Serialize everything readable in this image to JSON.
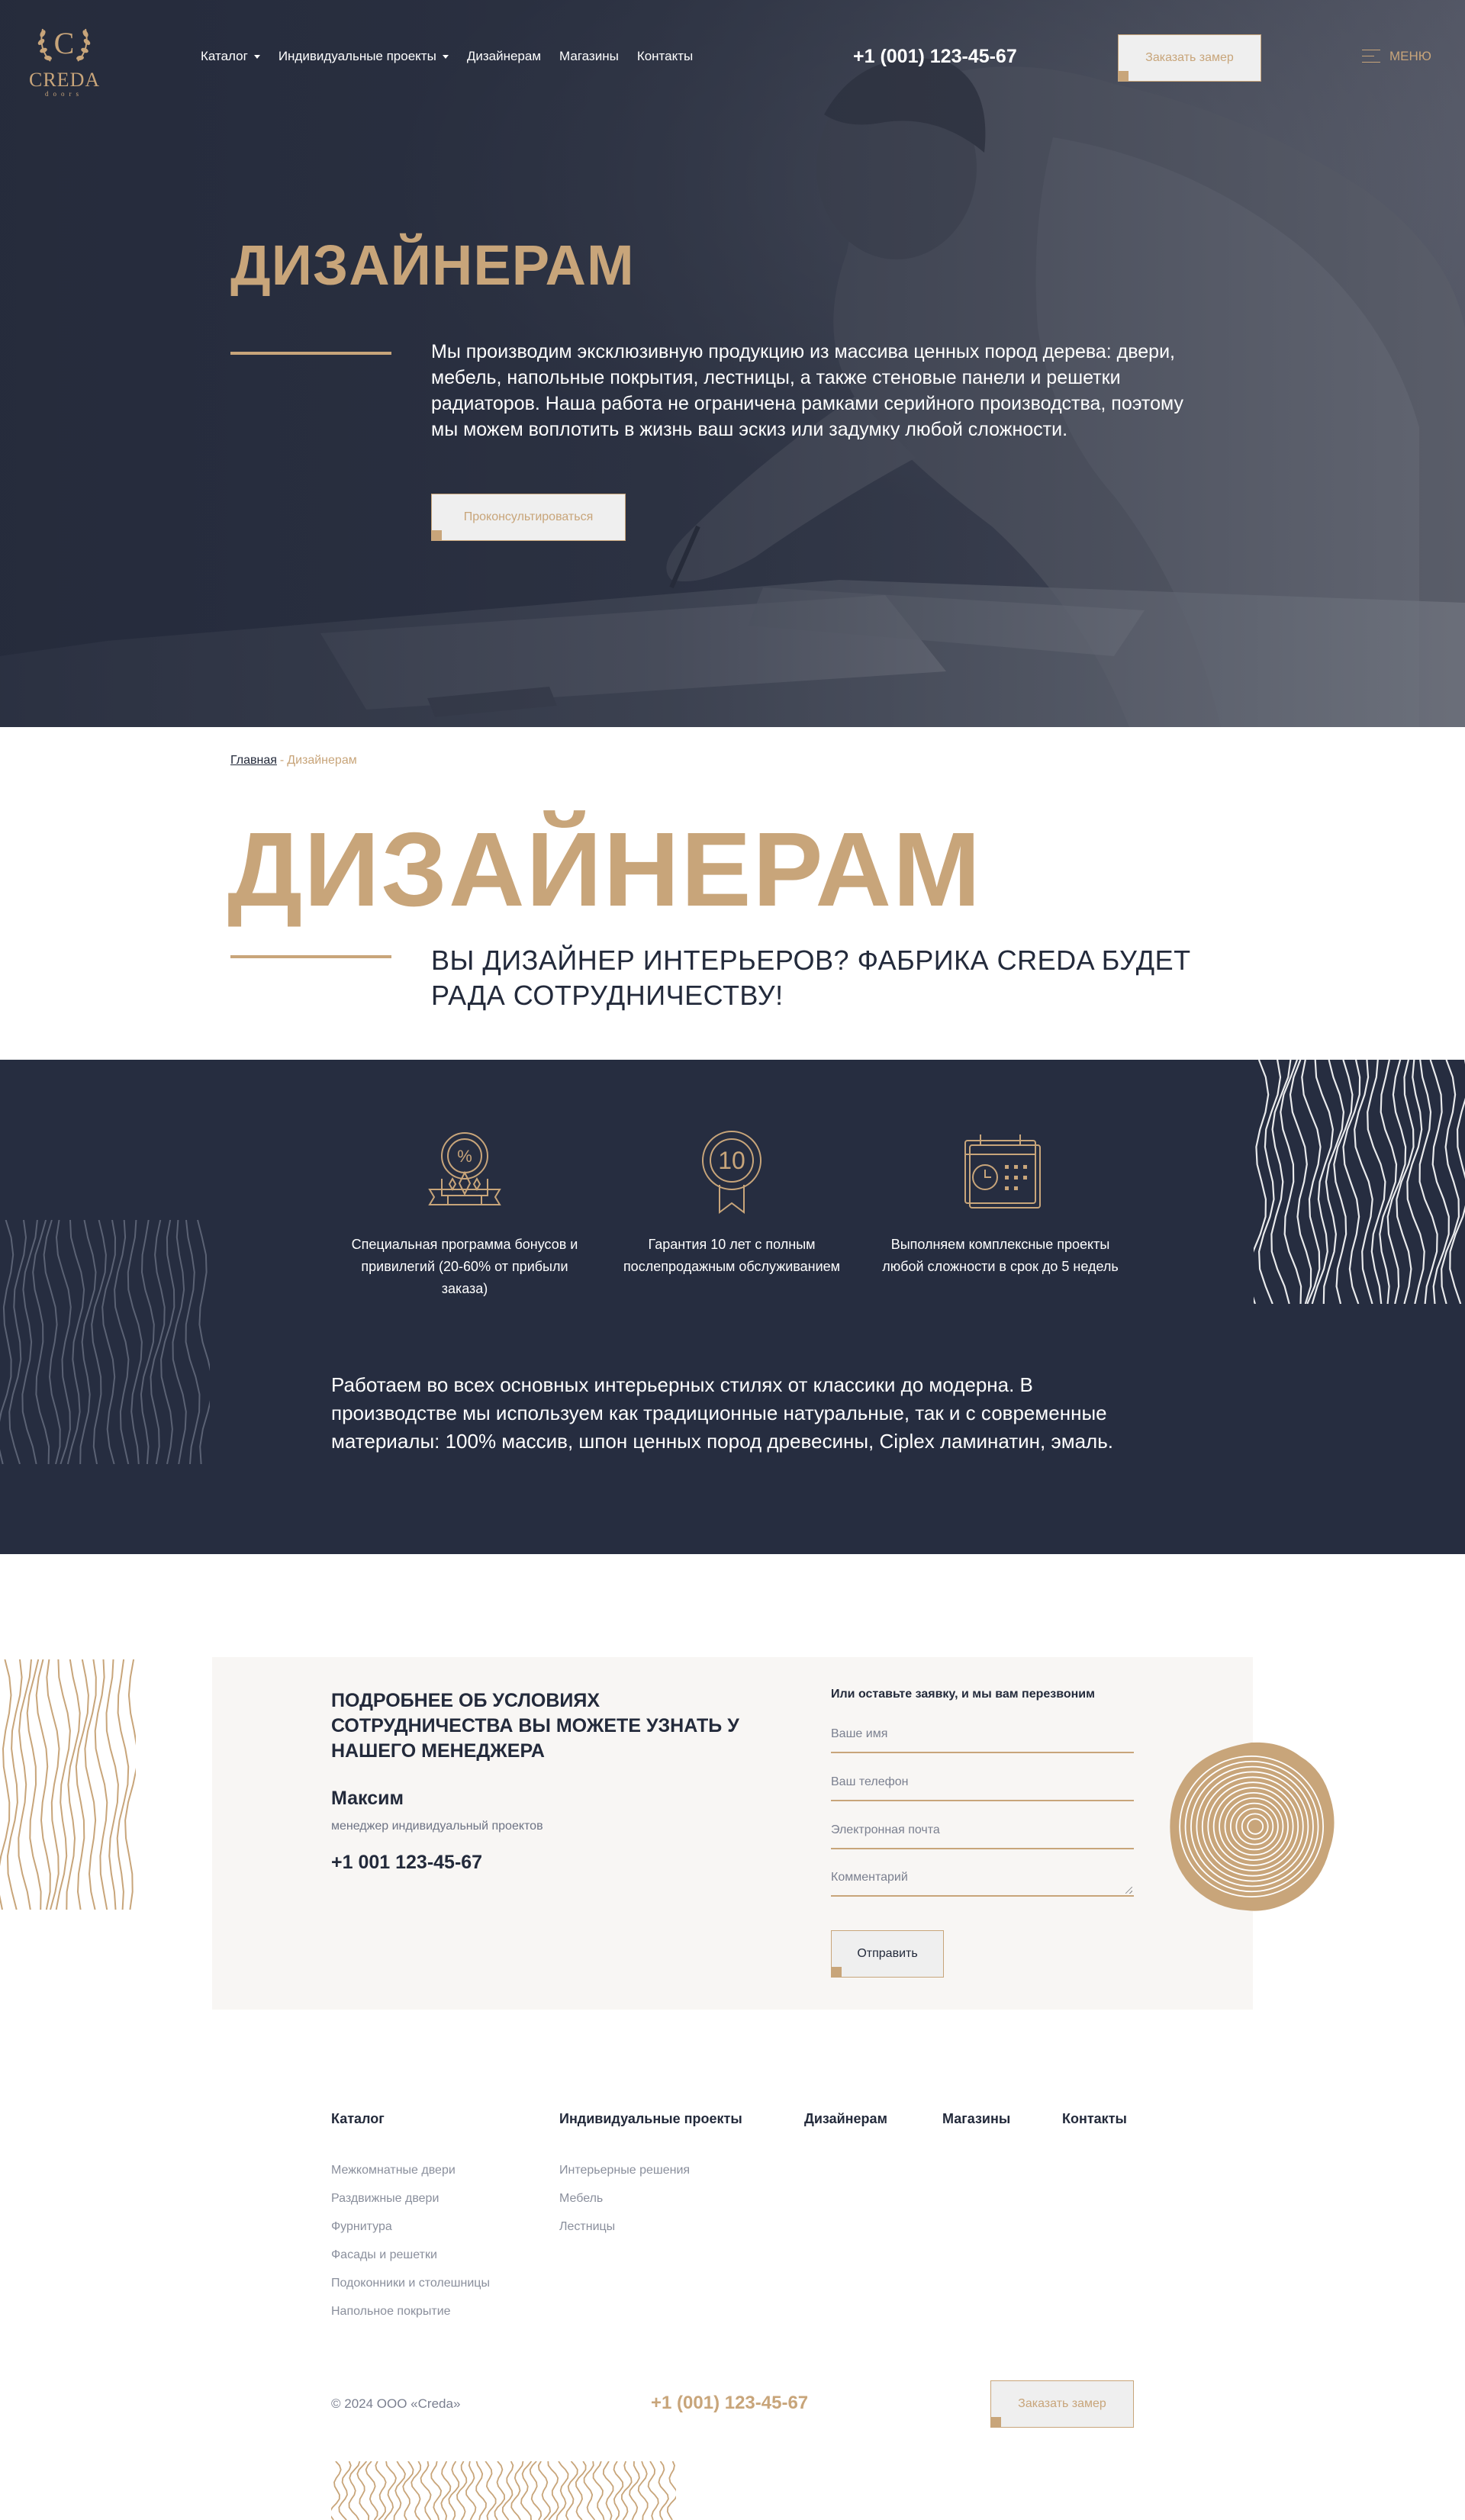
{
  "brand": {
    "name": "CREDA",
    "sub": "doors",
    "letter": "C"
  },
  "nav": [
    {
      "label": "Каталог",
      "dropdown": true
    },
    {
      "label": "Индивидуальные проекты",
      "dropdown": true
    },
    {
      "label": "Дизайнерам",
      "dropdown": false
    },
    {
      "label": "Магазины",
      "dropdown": false
    },
    {
      "label": "Контакты",
      "dropdown": false
    }
  ],
  "header": {
    "phone": "+1 (001) 123-45-67",
    "order_label": "Заказать замер",
    "menu_label": "МЕНЮ"
  },
  "hero": {
    "title": "ДИЗАЙНЕРАМ",
    "text": "Мы производим эксклюзивную продукцию из массива ценных пород дерева: двери, мебель, напольные покрытия, лестницы, а также стеновые панели и решетки радиаторов. Наша работа не ограничена рамками серийного производства, поэтому мы можем воплотить в жизнь ваш эскиз или задумку любой сложности.",
    "button": "Проконсультироваться"
  },
  "breadcrumb": {
    "home": "Главная",
    "separator": "-",
    "current": "Дизайнерам"
  },
  "page": {
    "title": "ДИЗАЙНЕРАМ",
    "subtitle": "ВЫ ДИЗАЙНЕР ИНТЕРЬЕРОВ? ФАБРИКА CREDA БУДЕТ РАДА СОТРУДНИЧЕСТВУ!"
  },
  "features": {
    "items": [
      {
        "icon": "discount-badge-icon",
        "text": "Специальная программа бонусов и привилегий (20-60% от прибыли заказа)"
      },
      {
        "icon": "ten-year-award-icon",
        "text": "Гарантия 10 лет с полным послепродажным обслуживанием"
      },
      {
        "icon": "calendar-clock-icon",
        "text": "Выполняем комплексные проекты любой сложности в срок до 5 недель"
      }
    ],
    "award_number": "10",
    "description": "Работаем во всех основных интерьерных стилях от классики до модерна. В производстве мы используем как традиционные натуральные, так и с современные материалы: 100% массив, шпон ценных пород древесины, Ciplex ламинатин, эмаль."
  },
  "contact": {
    "heading": "ПОДРОБНЕЕ ОБ УСЛОВИЯХ СОТРУДНИЧЕСТВА ВЫ МОЖЕТЕ УЗНАТЬ У НАШЕГО МЕНЕДЖЕРА",
    "manager_name": "Максим",
    "manager_role": "менеджер индивидуальный проектов",
    "manager_phone": "+1 001 123-45-67",
    "form_title": "Или оставьте заявку, и мы вам перезвоним",
    "fields": {
      "name": {
        "placeholder": "Ваше имя",
        "value": ""
      },
      "phone": {
        "placeholder": "Ваш телефон",
        "value": ""
      },
      "email": {
        "placeholder": "Электронная почта",
        "value": ""
      },
      "comment": {
        "placeholder": "Комментарий",
        "value": ""
      }
    },
    "submit_label": "Отправить"
  },
  "footer": {
    "columns": [
      {
        "heading": "Каталог",
        "links": [
          "Межкомнатные двери",
          "Раздвижные двери",
          "Фурнитура",
          "Фасады и решетки",
          "Подоконники и столешницы",
          "Напольное покрытие"
        ]
      },
      {
        "heading": "Индивидуальные проекты",
        "links": [
          "Интерьерные решения",
          "Мебель",
          "Лестницы"
        ]
      },
      {
        "heading": "Дизайнерам",
        "links": []
      },
      {
        "heading": "Магазины",
        "links": []
      },
      {
        "heading": "Контакты",
        "links": []
      }
    ],
    "copyright": "© 2024 ООО «Creda»",
    "phone": "+1 (001) 123-45-67",
    "order_label": "Заказать замер"
  },
  "colors": {
    "accent": "#c8a57a",
    "navy": "#262d40",
    "light_panel": "#f8f6f4",
    "text": "#232a3b"
  }
}
